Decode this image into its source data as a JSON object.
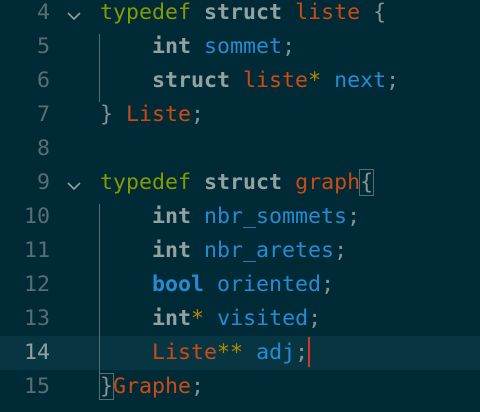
{
  "editor": {
    "lines": [
      {
        "number": "4",
        "folded_open": true,
        "tokens": [
          {
            "t": "typedef",
            "c": "kw"
          },
          {
            "t": " ",
            "c": "pn"
          },
          {
            "t": "struct",
            "c": "st"
          },
          {
            "t": " ",
            "c": "pn"
          },
          {
            "t": "liste",
            "c": "nm"
          },
          {
            "t": " {",
            "c": "pn"
          }
        ]
      },
      {
        "number": "5",
        "folded_open": false,
        "tokens": [
          {
            "t": "    ",
            "c": "pn"
          },
          {
            "t": "int",
            "c": "ty"
          },
          {
            "t": " ",
            "c": "pn"
          },
          {
            "t": "sommet",
            "c": "fd"
          },
          {
            "t": ";",
            "c": "pn"
          }
        ]
      },
      {
        "number": "6",
        "folded_open": false,
        "tokens": [
          {
            "t": "    ",
            "c": "pn"
          },
          {
            "t": "struct",
            "c": "st"
          },
          {
            "t": " ",
            "c": "pn"
          },
          {
            "t": "liste",
            "c": "nm"
          },
          {
            "t": "*",
            "c": "op"
          },
          {
            "t": " ",
            "c": "pn"
          },
          {
            "t": "next",
            "c": "fd"
          },
          {
            "t": ";",
            "c": "pn"
          }
        ]
      },
      {
        "number": "7",
        "folded_open": false,
        "tokens": [
          {
            "t": "} ",
            "c": "pn"
          },
          {
            "t": "Liste",
            "c": "nm"
          },
          {
            "t": ";",
            "c": "pn"
          }
        ]
      },
      {
        "number": "8",
        "folded_open": false,
        "tokens": []
      },
      {
        "number": "9",
        "folded_open": true,
        "tokens": [
          {
            "t": "typedef",
            "c": "kw"
          },
          {
            "t": " ",
            "c": "pn"
          },
          {
            "t": "struct",
            "c": "st"
          },
          {
            "t": " ",
            "c": "pn"
          },
          {
            "t": "graph",
            "c": "nm"
          },
          {
            "t": "{",
            "c": "pn",
            "hl": true
          }
        ]
      },
      {
        "number": "10",
        "folded_open": false,
        "tokens": [
          {
            "t": "    ",
            "c": "pn"
          },
          {
            "t": "int",
            "c": "ty"
          },
          {
            "t": " ",
            "c": "pn"
          },
          {
            "t": "nbr_sommets",
            "c": "fd"
          },
          {
            "t": ";",
            "c": "pn"
          }
        ]
      },
      {
        "number": "11",
        "folded_open": false,
        "tokens": [
          {
            "t": "    ",
            "c": "pn"
          },
          {
            "t": "int",
            "c": "ty"
          },
          {
            "t": " ",
            "c": "pn"
          },
          {
            "t": "nbr_aretes",
            "c": "fd"
          },
          {
            "t": ";",
            "c": "pn"
          }
        ]
      },
      {
        "number": "12",
        "folded_open": false,
        "tokens": [
          {
            "t": "    ",
            "c": "pn"
          },
          {
            "t": "bool",
            "c": "ty-b"
          },
          {
            "t": " ",
            "c": "pn"
          },
          {
            "t": "oriented",
            "c": "fd"
          },
          {
            "t": ";",
            "c": "pn"
          }
        ]
      },
      {
        "number": "13",
        "folded_open": false,
        "tokens": [
          {
            "t": "    ",
            "c": "pn"
          },
          {
            "t": "int",
            "c": "ty"
          },
          {
            "t": "*",
            "c": "op"
          },
          {
            "t": " ",
            "c": "pn"
          },
          {
            "t": "visited",
            "c": "fd"
          },
          {
            "t": ";",
            "c": "pn"
          }
        ]
      },
      {
        "number": "14",
        "folded_open": false,
        "active": true,
        "caret": true,
        "tokens": [
          {
            "t": "    ",
            "c": "pn"
          },
          {
            "t": "Liste",
            "c": "nm"
          },
          {
            "t": "**",
            "c": "op"
          },
          {
            "t": " ",
            "c": "pn"
          },
          {
            "t": "adj",
            "c": "fd"
          },
          {
            "t": ";",
            "c": "pn"
          }
        ]
      },
      {
        "number": "15",
        "folded_open": false,
        "tokens": [
          {
            "t": "}",
            "c": "pn",
            "hl": true
          },
          {
            "t": "Graphe",
            "c": "nm"
          },
          {
            "t": ";",
            "c": "pn"
          }
        ]
      }
    ]
  },
  "colors": {
    "background": "#002b36",
    "active_line": "#073642",
    "keyword": "#859900",
    "name": "#cb4b16",
    "field": "#268bd2",
    "caret": "#dc322f"
  },
  "icons": {
    "fold": "chevron-down-icon"
  }
}
